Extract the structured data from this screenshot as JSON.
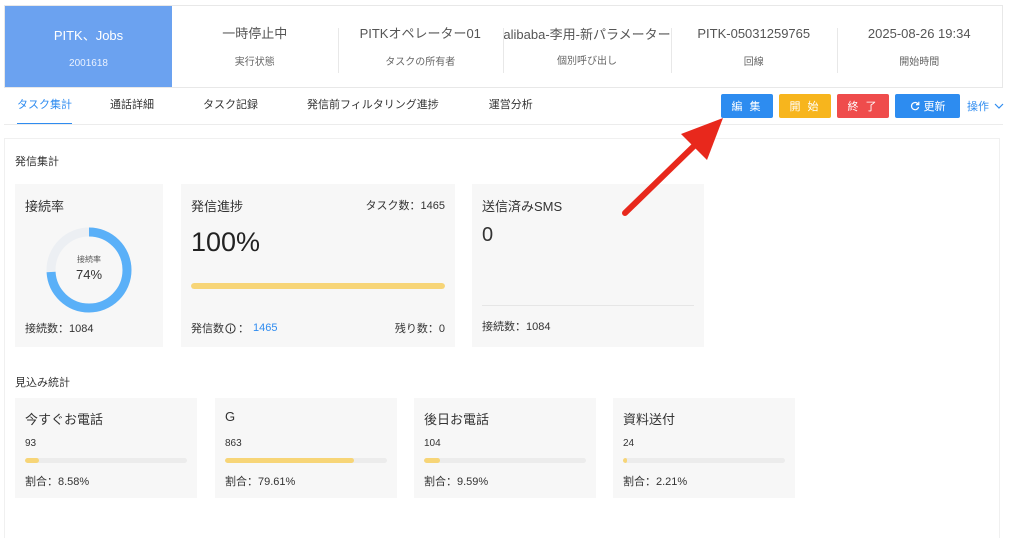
{
  "header": {
    "job_title": "PITK、Jobs",
    "job_id": "2001618",
    "cells": [
      {
        "value": "一時停止中",
        "label": "実行状態"
      },
      {
        "value": "PITKオペレーター01",
        "label": "タスクの所有者"
      },
      {
        "value": "alibaba-李用-新パラメーター",
        "label": "個別呼び出し"
      },
      {
        "value": "PITK-05031259765",
        "label": "回線"
      },
      {
        "value": "2025-08-26 19:34",
        "label": "開始時間"
      }
    ]
  },
  "tabs": [
    {
      "label": "タスク集計",
      "active": true
    },
    {
      "label": "通話詳細",
      "active": false
    },
    {
      "label": "タスク記録",
      "active": false
    },
    {
      "label": "発信前フィルタリング進捗",
      "active": false
    },
    {
      "label": "運営分析",
      "active": false
    }
  ],
  "actions": {
    "edit": "編 集",
    "start": "開 始",
    "end": "終 了",
    "refresh": "更新",
    "ops": "操作"
  },
  "colors": {
    "primary": "#2d8cf0",
    "warning": "#f7b51d",
    "danger": "#ef4c4c",
    "ring": "#5ab0f8",
    "bar": "#f7d577",
    "job_card": "#6ba2f0",
    "arrow": "#e8281c"
  },
  "dial_stats": {
    "section_title": "発信集計",
    "connect": {
      "title": "接続率",
      "ring_label": "接続率",
      "ring_value": "74%",
      "ring_fraction": 0.74,
      "foot": "接続数：1084"
    },
    "progress": {
      "title": "発信進捗",
      "task_count": "タスク数：1465",
      "percent": "100%",
      "fraction": 1.0,
      "dial_label": "発信数",
      "dial_value": "1465",
      "remaining": "残り数：0"
    },
    "sms": {
      "title": "送信済みSMS",
      "value": "0",
      "foot": "接続数：1084"
    }
  },
  "prospect_stats": {
    "section_title": "見込み統計",
    "cards": [
      {
        "title": "今すぐお電話",
        "count": "93",
        "fraction": 0.0858,
        "ratio": "割合：8.58%"
      },
      {
        "title": "G",
        "count": "863",
        "fraction": 0.7961,
        "ratio": "割合：79.61%"
      },
      {
        "title": "後日お電話",
        "count": "104",
        "fraction": 0.0959,
        "ratio": "割合：9.59%"
      },
      {
        "title": "資料送付",
        "count": "24",
        "fraction": 0.0221,
        "ratio": "割合：2.21%"
      }
    ]
  }
}
